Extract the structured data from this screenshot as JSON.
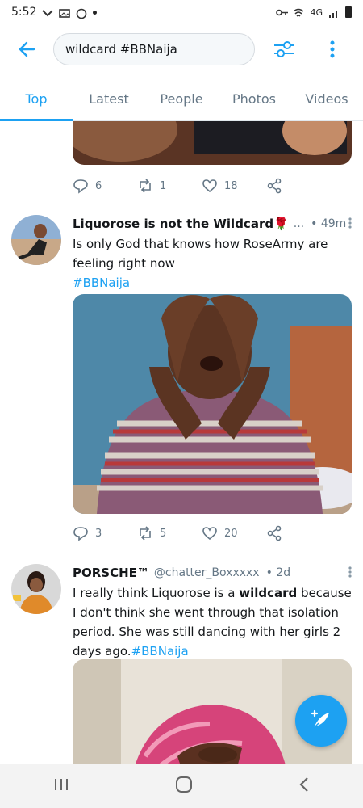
{
  "status_bar": {
    "time": "5:52",
    "network": "4G"
  },
  "search": {
    "query": "wildcard #BBNaija"
  },
  "tabs": [
    "Top",
    "Latest",
    "People",
    "Photos",
    "Videos"
  ],
  "prev_tweet": {
    "replies": "6",
    "retweets": "1",
    "likes": "18"
  },
  "tweet1": {
    "name": "Liquorose is not the Wildcard🌹",
    "name_suffix": "...",
    "time": "49m",
    "text": "Is only God that knows how RoseArmy are feeling right now",
    "hashtag": "#BBNaija",
    "replies": "3",
    "retweets": "5",
    "likes": "20"
  },
  "tweet2": {
    "name": "PORSCHE™",
    "handle": "@chatter_Boxxxxx",
    "time": "2d",
    "text_before": "I really think Liquorose is a",
    "highlight": "wildcard",
    "text_after": "because I don't think she went through that isolation period. She was still dancing with her girls 2 days ago.",
    "hashtag": "#BBNaija"
  },
  "colors": {
    "accent": "#1da1f2",
    "muted": "#657786"
  }
}
